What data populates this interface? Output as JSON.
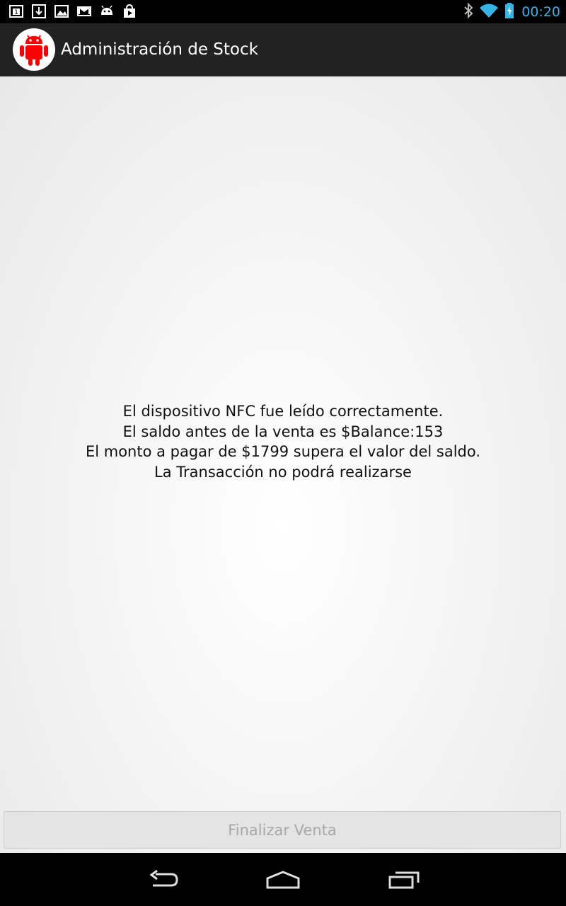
{
  "status_bar": {
    "left_icons": [
      "sim-card-1-icon",
      "download-icon",
      "gallery-icon",
      "gmail-icon",
      "android-debug-icon",
      "play-store-icon"
    ],
    "right_icons": [
      "bluetooth-icon",
      "wifi-icon",
      "battery-charging-icon"
    ],
    "time": "00:20",
    "time_color": "#33b5e5"
  },
  "action_bar": {
    "title": "Administración de Stock",
    "icon": "android-robot-icon",
    "icon_color": "#ff0000"
  },
  "message": {
    "lines": [
      "El dispositivo NFC fue leído correctamente.",
      "El saldo antes de la venta es $Balance:153",
      "El monto a pagar de $1799 supera el valor del saldo.",
      "La Transacción no podrá realizarse"
    ]
  },
  "button": {
    "label": "Finalizar Venta",
    "enabled": false
  },
  "nav_bar": {
    "buttons": [
      "back-icon",
      "home-icon",
      "recent-apps-icon"
    ]
  }
}
